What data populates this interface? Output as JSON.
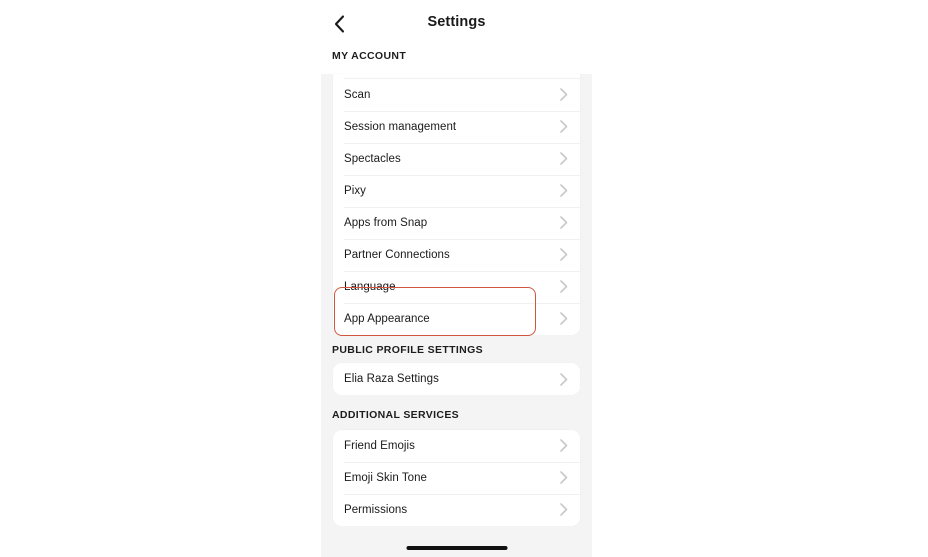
{
  "header": {
    "back_icon": "chevron-left-icon",
    "title": "Settings"
  },
  "sections": [
    {
      "id": "my-account",
      "heading": "MY ACCOUNT",
      "items": [
        {
          "label": "Scan",
          "accessory": "chevron-right-icon"
        },
        {
          "label": "Session management",
          "accessory": "chevron-right-icon"
        },
        {
          "label": "Spectacles",
          "accessory": "chevron-right-icon"
        },
        {
          "label": "Pixy",
          "accessory": "chevron-right-icon"
        },
        {
          "label": "Apps from Snap",
          "accessory": "chevron-right-icon"
        },
        {
          "label": "Partner Connections",
          "accessory": "chevron-right-icon"
        },
        {
          "label": "Language",
          "accessory": "chevron-right-icon"
        },
        {
          "label": "App Appearance",
          "accessory": "chevron-right-icon"
        }
      ]
    },
    {
      "id": "public-profile-settings",
      "heading": "PUBLIC PROFILE SETTINGS",
      "items": [
        {
          "label": "Elia Raza Settings",
          "accessory": "chevron-right-icon"
        }
      ]
    },
    {
      "id": "additional-services",
      "heading": "ADDITIONAL SERVICES",
      "items": [
        {
          "label": "Friend Emojis",
          "accessory": "chevron-right-icon"
        },
        {
          "label": "Emoji Skin Tone",
          "accessory": "chevron-right-icon"
        },
        {
          "label": "Permissions",
          "accessory": "chevron-right-icon"
        }
      ]
    }
  ],
  "annotation": {
    "target_label": "App Appearance",
    "color": "#d2553f"
  },
  "system": {
    "home_indicator": "home-indicator"
  },
  "colors": {
    "page_background": "#f4f4f4",
    "card_background": "#ffffff",
    "text_primary": "#1a1a1a",
    "chevron": "#c8c8c8",
    "separator": "#f0f0f0",
    "home_indicator": "#111111"
  }
}
